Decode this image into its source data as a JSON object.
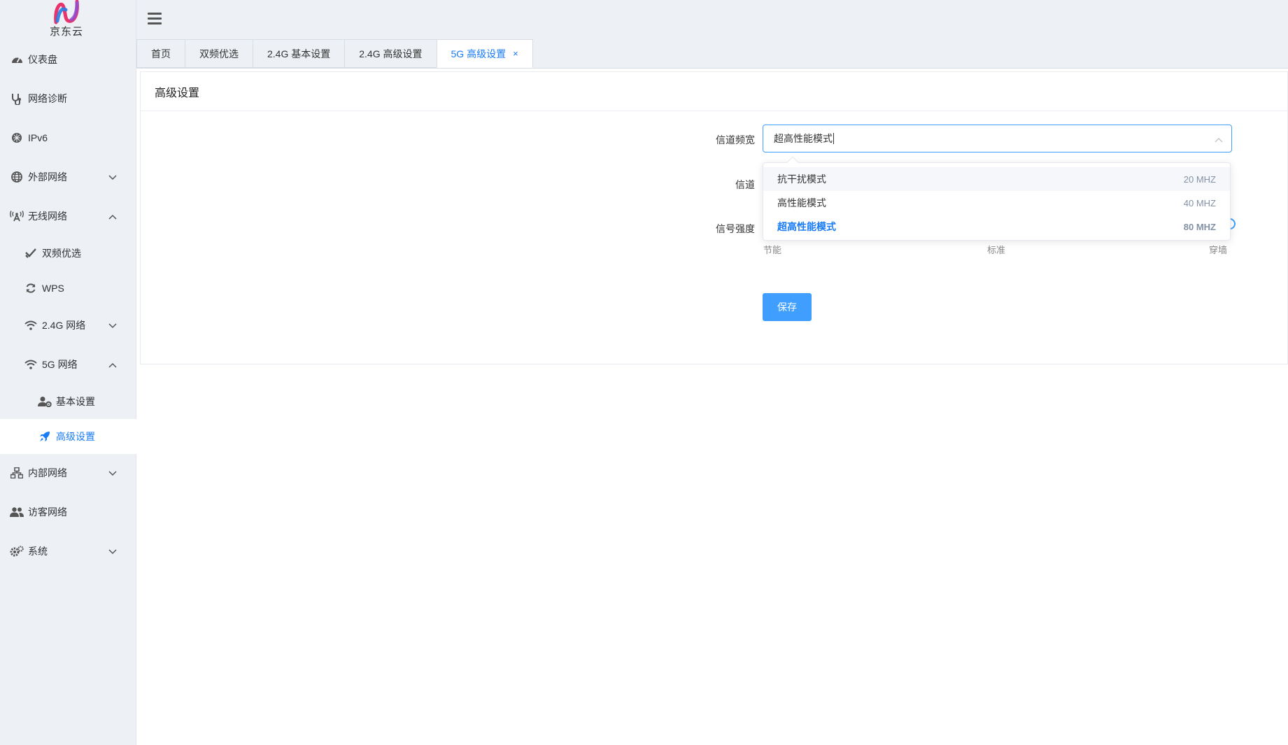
{
  "app": {
    "logo_text": "京东云"
  },
  "sidebar": {
    "items": [
      {
        "label": "仪表盘"
      },
      {
        "label": "网络诊断"
      },
      {
        "label": "IPv6"
      },
      {
        "label": "外部网络"
      },
      {
        "label": "无线网络"
      },
      {
        "label": "双频优选"
      },
      {
        "label": "WPS"
      },
      {
        "label": "2.4G 网络"
      },
      {
        "label": "5G 网络"
      },
      {
        "label": "基本设置"
      },
      {
        "label": "高级设置"
      },
      {
        "label": "内部网络"
      },
      {
        "label": "访客网络"
      },
      {
        "label": "系统"
      }
    ]
  },
  "tabs": [
    {
      "label": "首页"
    },
    {
      "label": "双频优选"
    },
    {
      "label": "2.4G 基本设置"
    },
    {
      "label": "2.4G 高级设置"
    },
    {
      "label": "5G 高级设置",
      "close": "×"
    }
  ],
  "card": {
    "title": "高级设置"
  },
  "form": {
    "bandwidth_label": "信道频宽",
    "bandwidth_value": "超高性能模式",
    "channel_label": "信道",
    "signal_label": "信号强度",
    "signal_levels": [
      "节能",
      "标准",
      "穿墙"
    ],
    "save_label": "保存"
  },
  "dropdown": {
    "options": [
      {
        "label": "抗干扰模式",
        "right": "20 MHZ"
      },
      {
        "label": "高性能模式",
        "right": "40 MHZ"
      },
      {
        "label": "超高性能模式",
        "right": "80 MHZ"
      }
    ]
  },
  "colors": {
    "accent": "#409eff",
    "active_text": "#1a7cf5",
    "sidebar_bg": "#edf1f6"
  }
}
